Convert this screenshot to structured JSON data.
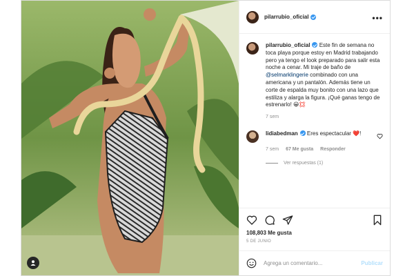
{
  "post": {
    "username": "pilarrubio_oficial",
    "more_label": "•••",
    "caption": {
      "username": "pilarrubio_oficial",
      "text_before": " Este fin de semana no toca playa porque estoy en Madrid trabajando pero ya tengo el look preparado para salir esta noche a cenar. Mi traje de baño de ",
      "mention": "@selmarklingerie",
      "text_after": " combinado con una americana y un pantalón. Además tiene un corte de espalda muy bonito con una lazo que estiliza y alarga la figura. ¡Qué ganas tengo de estrenarlo! 😀💢",
      "time": "7 sem"
    },
    "comment": {
      "username": "lidiabedman",
      "text": " Eres espectacular ❤️!",
      "time": "7 sem",
      "likes": "67 Me gusta",
      "reply_label": "Responder",
      "view_replies": "Ver respuestas (1)"
    },
    "likes": "108,803 Me gusta",
    "date": "5 DE JUNIO",
    "add_comment_placeholder": "Agrega un comentario...",
    "publish_label": "Publicar"
  },
  "icons": [
    "heart-icon",
    "comment-icon",
    "share-icon",
    "bookmark-icon",
    "emoji-icon",
    "user-tag-icon",
    "more-icon"
  ],
  "colors": {
    "verified": "#3897f0",
    "muted": "#8e8e8e",
    "text": "#262626",
    "publish": "#b2dffc"
  }
}
